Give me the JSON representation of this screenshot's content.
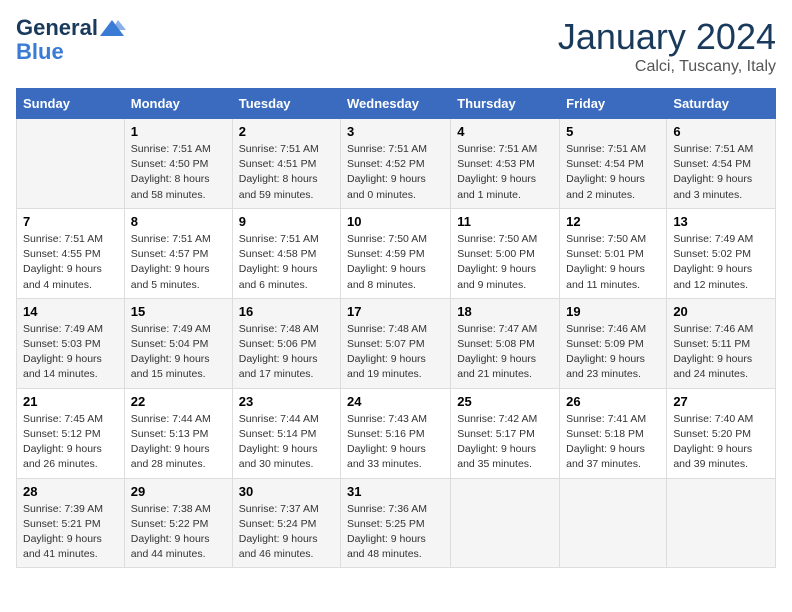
{
  "header": {
    "logo_general": "General",
    "logo_blue": "Blue",
    "month_title": "January 2024",
    "location": "Calci, Tuscany, Italy"
  },
  "days_of_week": [
    "Sunday",
    "Monday",
    "Tuesday",
    "Wednesday",
    "Thursday",
    "Friday",
    "Saturday"
  ],
  "weeks": [
    [
      {
        "day": "",
        "info": ""
      },
      {
        "day": "1",
        "info": "Sunrise: 7:51 AM\nSunset: 4:50 PM\nDaylight: 8 hours\nand 58 minutes."
      },
      {
        "day": "2",
        "info": "Sunrise: 7:51 AM\nSunset: 4:51 PM\nDaylight: 8 hours\nand 59 minutes."
      },
      {
        "day": "3",
        "info": "Sunrise: 7:51 AM\nSunset: 4:52 PM\nDaylight: 9 hours\nand 0 minutes."
      },
      {
        "day": "4",
        "info": "Sunrise: 7:51 AM\nSunset: 4:53 PM\nDaylight: 9 hours\nand 1 minute."
      },
      {
        "day": "5",
        "info": "Sunrise: 7:51 AM\nSunset: 4:54 PM\nDaylight: 9 hours\nand 2 minutes."
      },
      {
        "day": "6",
        "info": "Sunrise: 7:51 AM\nSunset: 4:54 PM\nDaylight: 9 hours\nand 3 minutes."
      }
    ],
    [
      {
        "day": "7",
        "info": "Sunrise: 7:51 AM\nSunset: 4:55 PM\nDaylight: 9 hours\nand 4 minutes."
      },
      {
        "day": "8",
        "info": "Sunrise: 7:51 AM\nSunset: 4:57 PM\nDaylight: 9 hours\nand 5 minutes."
      },
      {
        "day": "9",
        "info": "Sunrise: 7:51 AM\nSunset: 4:58 PM\nDaylight: 9 hours\nand 6 minutes."
      },
      {
        "day": "10",
        "info": "Sunrise: 7:50 AM\nSunset: 4:59 PM\nDaylight: 9 hours\nand 8 minutes."
      },
      {
        "day": "11",
        "info": "Sunrise: 7:50 AM\nSunset: 5:00 PM\nDaylight: 9 hours\nand 9 minutes."
      },
      {
        "day": "12",
        "info": "Sunrise: 7:50 AM\nSunset: 5:01 PM\nDaylight: 9 hours\nand 11 minutes."
      },
      {
        "day": "13",
        "info": "Sunrise: 7:49 AM\nSunset: 5:02 PM\nDaylight: 9 hours\nand 12 minutes."
      }
    ],
    [
      {
        "day": "14",
        "info": "Sunrise: 7:49 AM\nSunset: 5:03 PM\nDaylight: 9 hours\nand 14 minutes."
      },
      {
        "day": "15",
        "info": "Sunrise: 7:49 AM\nSunset: 5:04 PM\nDaylight: 9 hours\nand 15 minutes."
      },
      {
        "day": "16",
        "info": "Sunrise: 7:48 AM\nSunset: 5:06 PM\nDaylight: 9 hours\nand 17 minutes."
      },
      {
        "day": "17",
        "info": "Sunrise: 7:48 AM\nSunset: 5:07 PM\nDaylight: 9 hours\nand 19 minutes."
      },
      {
        "day": "18",
        "info": "Sunrise: 7:47 AM\nSunset: 5:08 PM\nDaylight: 9 hours\nand 21 minutes."
      },
      {
        "day": "19",
        "info": "Sunrise: 7:46 AM\nSunset: 5:09 PM\nDaylight: 9 hours\nand 23 minutes."
      },
      {
        "day": "20",
        "info": "Sunrise: 7:46 AM\nSunset: 5:11 PM\nDaylight: 9 hours\nand 24 minutes."
      }
    ],
    [
      {
        "day": "21",
        "info": "Sunrise: 7:45 AM\nSunset: 5:12 PM\nDaylight: 9 hours\nand 26 minutes."
      },
      {
        "day": "22",
        "info": "Sunrise: 7:44 AM\nSunset: 5:13 PM\nDaylight: 9 hours\nand 28 minutes."
      },
      {
        "day": "23",
        "info": "Sunrise: 7:44 AM\nSunset: 5:14 PM\nDaylight: 9 hours\nand 30 minutes."
      },
      {
        "day": "24",
        "info": "Sunrise: 7:43 AM\nSunset: 5:16 PM\nDaylight: 9 hours\nand 33 minutes."
      },
      {
        "day": "25",
        "info": "Sunrise: 7:42 AM\nSunset: 5:17 PM\nDaylight: 9 hours\nand 35 minutes."
      },
      {
        "day": "26",
        "info": "Sunrise: 7:41 AM\nSunset: 5:18 PM\nDaylight: 9 hours\nand 37 minutes."
      },
      {
        "day": "27",
        "info": "Sunrise: 7:40 AM\nSunset: 5:20 PM\nDaylight: 9 hours\nand 39 minutes."
      }
    ],
    [
      {
        "day": "28",
        "info": "Sunrise: 7:39 AM\nSunset: 5:21 PM\nDaylight: 9 hours\nand 41 minutes."
      },
      {
        "day": "29",
        "info": "Sunrise: 7:38 AM\nSunset: 5:22 PM\nDaylight: 9 hours\nand 44 minutes."
      },
      {
        "day": "30",
        "info": "Sunrise: 7:37 AM\nSunset: 5:24 PM\nDaylight: 9 hours\nand 46 minutes."
      },
      {
        "day": "31",
        "info": "Sunrise: 7:36 AM\nSunset: 5:25 PM\nDaylight: 9 hours\nand 48 minutes."
      },
      {
        "day": "",
        "info": ""
      },
      {
        "day": "",
        "info": ""
      },
      {
        "day": "",
        "info": ""
      }
    ]
  ]
}
